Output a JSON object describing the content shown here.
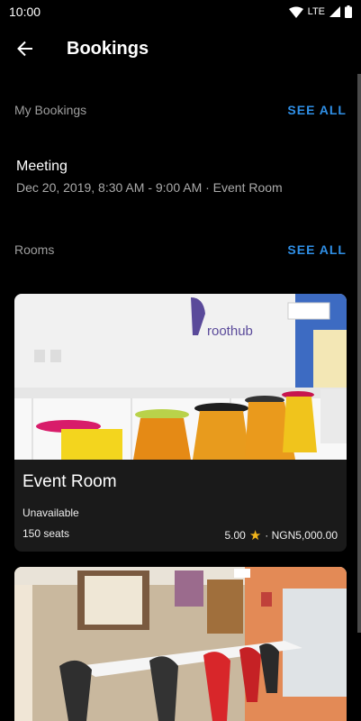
{
  "status_bar": {
    "time": "10:00",
    "network": "LTE"
  },
  "app_bar": {
    "title": "Bookings"
  },
  "my_bookings": {
    "label": "My Bookings",
    "see_all": "SEE ALL",
    "items": [
      {
        "title": "Meeting",
        "details": "Dec 20, 2019, 8:30 AM - 9:00 AM · Event Room"
      }
    ]
  },
  "rooms": {
    "label": "Rooms",
    "see_all": "SEE ALL",
    "items": [
      {
        "name": "Event Room",
        "status": "Unavailable",
        "seats": "150 seats",
        "rating": "5.00",
        "price": "· NGN5,000.00",
        "logo_text": "roothub"
      }
    ]
  },
  "colors": {
    "accent": "#2f8fe6",
    "star": "#f2b51b",
    "card": "#1a1a1a"
  }
}
